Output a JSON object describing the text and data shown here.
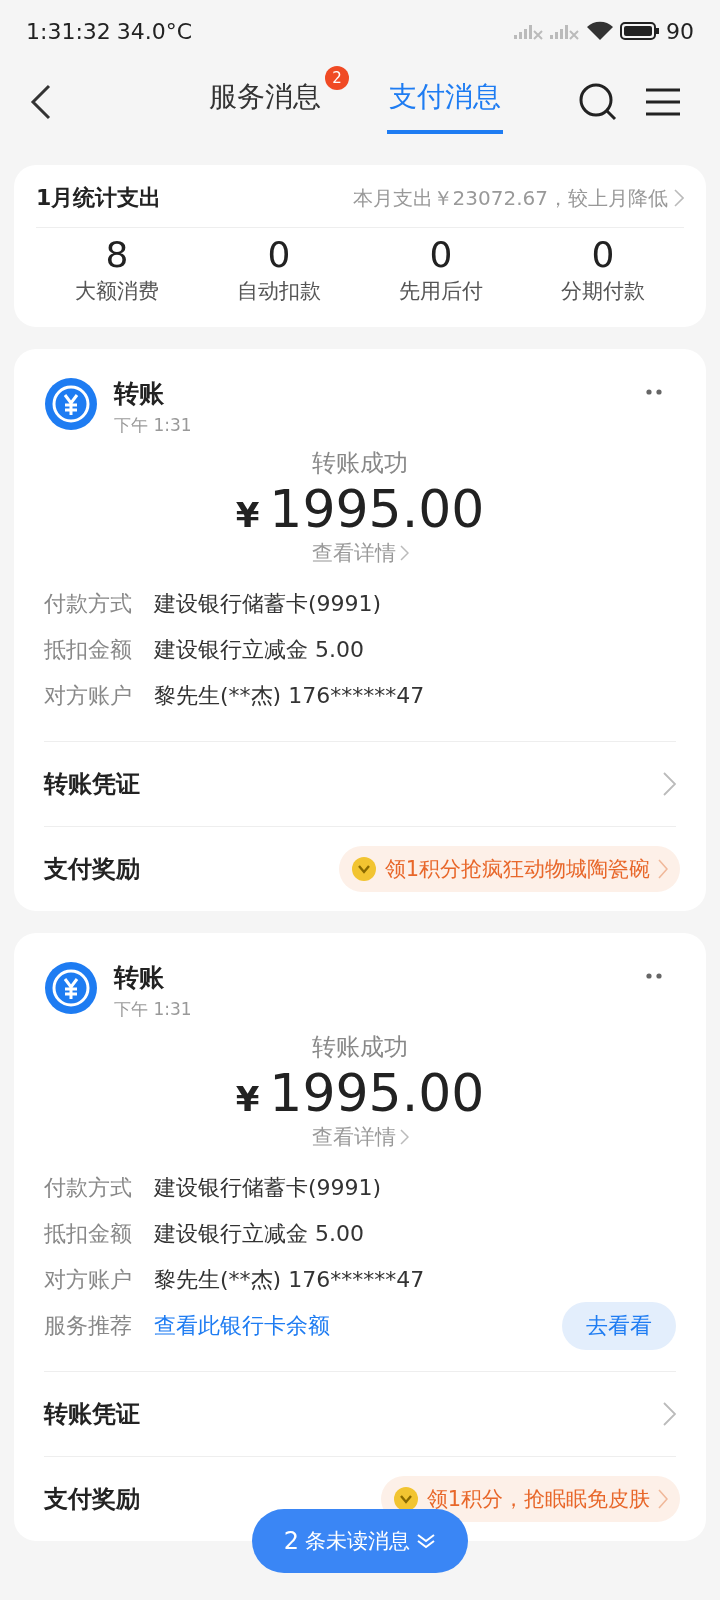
{
  "status_bar": {
    "time": "1:31:32",
    "temperature": "34.0°C",
    "battery": "90"
  },
  "tabs": [
    {
      "label": "服务消息",
      "selected": false,
      "badge": "2"
    },
    {
      "label": "支付消息",
      "selected": true
    }
  ],
  "summary": {
    "title": "1月统计支出",
    "note": "本月支出￥23072.67，较上月降低",
    "stats": [
      {
        "value": "8",
        "label": "大额消费"
      },
      {
        "value": "0",
        "label": "自动扣款"
      },
      {
        "value": "0",
        "label": "先用后付"
      },
      {
        "value": "0",
        "label": "分期付款"
      }
    ]
  },
  "cards": [
    {
      "title": "转账",
      "time": "下午 1:31",
      "status": "转账成功",
      "currency": "¥",
      "amount": "1995.00",
      "detail_link": "查看详情",
      "rows": [
        {
          "kind": "info",
          "label": "付款方式",
          "value": "建设银行储蓄卡(9991)"
        },
        {
          "kind": "info",
          "label": "抵扣金额",
          "value": "建设银行立减金 5.00"
        },
        {
          "kind": "info",
          "label": "对方账户",
          "value": "黎先生(**杰) 176******47"
        }
      ],
      "actions": [
        {
          "kind": "link",
          "label": "转账凭证"
        },
        {
          "kind": "reward",
          "label": "支付奖励",
          "promo": "领1积分抢疯狂动物城陶瓷碗"
        }
      ]
    },
    {
      "title": "转账",
      "time": "下午 1:31",
      "status": "转账成功",
      "currency": "¥",
      "amount": "1995.00",
      "detail_link": "查看详情",
      "rows": [
        {
          "kind": "info",
          "label": "付款方式",
          "value": "建设银行储蓄卡(9991)"
        },
        {
          "kind": "info",
          "label": "抵扣金额",
          "value": "建设银行立减金 5.00"
        },
        {
          "kind": "info",
          "label": "对方账户",
          "value": "黎先生(**杰) 176******47"
        },
        {
          "kind": "service",
          "label": "服务推荐",
          "value": "查看此银行卡余额",
          "button": "去看看"
        }
      ],
      "actions": [
        {
          "kind": "link",
          "label": "转账凭证"
        },
        {
          "kind": "reward",
          "label": "支付奖励",
          "promo": "领1积分，抢眠眠免皮肤"
        }
      ]
    }
  ],
  "unread_button": {
    "count": "2",
    "label": "条未读消息"
  }
}
